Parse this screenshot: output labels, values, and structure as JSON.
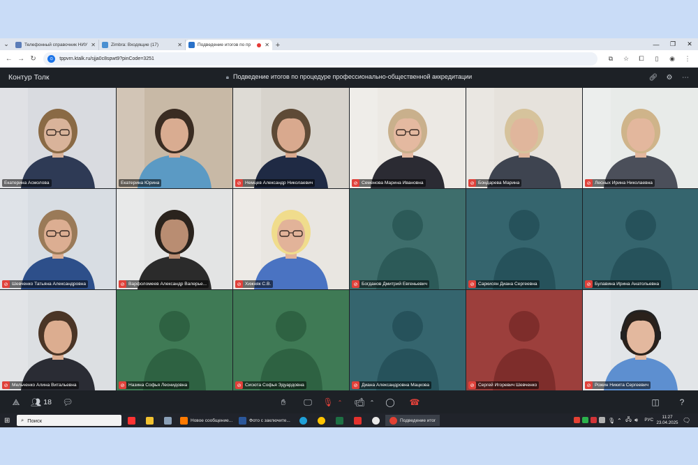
{
  "browser": {
    "tabs": [
      {
        "title": "Телефонный справочник НИУ",
        "favicon_color": "#5b7db8"
      },
      {
        "title": "Zimbra: Входящие (17)",
        "favicon_color": "#4a8fd1"
      },
      {
        "title": "Подведение итогов по пр",
        "favicon_color": "#2a72c9",
        "active": true
      }
    ],
    "url": "tppvrn.ktalk.ru/sjja0c8spwt9?pinCode=3251"
  },
  "app": {
    "brand": "Контур Толк",
    "meeting_title": "Подведение итогов по процедуре профессионально-общественной аккредитации",
    "participants_count": "18"
  },
  "participants": [
    {
      "name": "Екатерина Асмолова",
      "muted": false,
      "speaking": true,
      "video": true,
      "bg": "#d9dbe0",
      "skin": "#d9b39a",
      "hair": "#8a6a45",
      "shirt": "#2e3a55",
      "glasses": true
    },
    {
      "name": "Екатерина Юрина",
      "muted": false,
      "video": true,
      "bg": "#c8b9a6",
      "skin": "#d9ac91",
      "hair": "#3a2c22",
      "shirt": "#5b9ac4"
    },
    {
      "name": "Немцев Александр Николаевич",
      "muted": true,
      "video": true,
      "bg": "#d7d3cc",
      "skin": "#d9a98e",
      "hair": "#5e4a36",
      "shirt": "#1f2a44"
    },
    {
      "name": "Семенова Марина Ивановна",
      "muted": true,
      "video": true,
      "bg": "#ece9e4",
      "skin": "#e4b9a0",
      "hair": "#c9b08c",
      "shirt": "#2b2b33",
      "glasses": true
    },
    {
      "name": "Бондарева Марина",
      "muted": true,
      "video": true,
      "bg": "#e6e2dc",
      "skin": "#e0b69c",
      "hair": "#d6c39c",
      "shirt": "#3e4450"
    },
    {
      "name": "Лесных Ирина Николаевна",
      "muted": true,
      "video": true,
      "bg": "#e8ebe9",
      "skin": "#e3b79d",
      "hair": "#cfb48a",
      "shirt": "#4b4f5a"
    },
    {
      "name": "Шевченко Татьяна Александровна",
      "muted": true,
      "video": true,
      "bg": "#d8dde3",
      "skin": "#dcae92",
      "hair": "#9a7a58",
      "shirt": "#2d4f8a",
      "glasses": true
    },
    {
      "name": "Варфоломеев Александр Валерье...",
      "muted": true,
      "video": true,
      "bg": "#e3e4e4",
      "skin": "#b98d72",
      "hair": "#2a231d",
      "shirt": "#2b2b2b"
    },
    {
      "name": "Хижняк С.В.",
      "muted": true,
      "video": true,
      "bg": "#e9e6e1",
      "skin": "#e2b399",
      "hair": "#f0dc8c",
      "shirt": "#4a73c2",
      "glasses": true
    },
    {
      "name": "Богданов Дмитрий Евгеньевич",
      "muted": true,
      "video": false,
      "bg": "#3e6e6c",
      "fg": "#2c5a58"
    },
    {
      "name": "Саркисян Диана Сергеевна",
      "muted": true,
      "video": false,
      "bg": "#35656e",
      "fg": "#26525b"
    },
    {
      "name": "Булавина Ирина Анатольевна",
      "muted": true,
      "video": false,
      "bg": "#35656e",
      "fg": "#26525b"
    },
    {
      "name": "Мельченко Алина Витальевна",
      "muted": true,
      "video": true,
      "bg": "#dcdfe2",
      "skin": "#dcad90",
      "hair": "#4a3526",
      "shirt": "#2a2c34"
    },
    {
      "name": "Назина Софья Леонидовна",
      "muted": true,
      "video": false,
      "bg": "#3f7a55",
      "fg": "#2e6242"
    },
    {
      "name": "Сисюта Софья Эдуардовна",
      "muted": true,
      "video": false,
      "bg": "#3f7a55",
      "fg": "#2e6242"
    },
    {
      "name": "Диана Александровна Мацкова",
      "muted": true,
      "video": false,
      "bg": "#35656e",
      "fg": "#26525b"
    },
    {
      "name": "Сергей Игоревич Шевченко",
      "muted": true,
      "video": false,
      "bg": "#9c3f3c",
      "fg": "#7e2d2b"
    },
    {
      "name": "Рожин Никита Сергеевич",
      "muted": true,
      "video": true,
      "bg": "#e2e5e8",
      "skin": "#e3b89e",
      "hair": "#2a211b",
      "shirt": "#5d8fd0",
      "headset": true
    }
  ],
  "taskbar": {
    "search_placeholder": "Поиск",
    "apps": [
      {
        "label": "Новое сообщение...",
        "color": "#ff7a00"
      },
      {
        "label": "Фото с заключите...",
        "color": "#2b579a"
      },
      {
        "label": "Подведение итого...",
        "color": "#e34133",
        "active": true
      }
    ],
    "lang": "РУС",
    "time": "11:27",
    "date": "23.04.2025"
  }
}
